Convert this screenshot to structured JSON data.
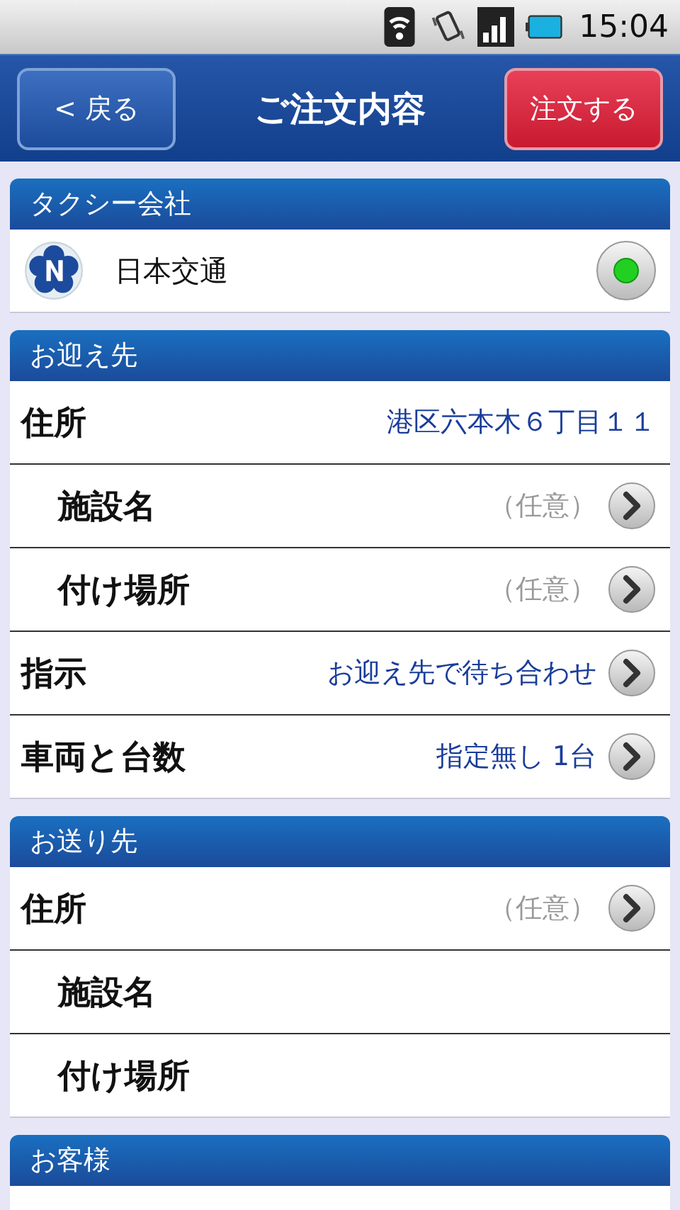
{
  "status_bar": {
    "time": "15:04"
  },
  "header": {
    "back": "< 戻る",
    "title": "ご注文内容",
    "order": "注文する"
  },
  "sections": [
    {
      "title": "タクシー会社",
      "kind": "company",
      "company": {
        "name": "日本交通",
        "selected": true
      }
    },
    {
      "title": "お迎え先",
      "kind": "rows",
      "rows": [
        {
          "label": "住所",
          "indent": false,
          "value": "港区六本木６丁目１１",
          "muted": false,
          "chevron": false
        },
        {
          "label": "施設名",
          "indent": true,
          "value": "（任意）",
          "muted": true,
          "chevron": true
        },
        {
          "label": "付け場所",
          "indent": true,
          "value": "（任意）",
          "muted": true,
          "chevron": true
        },
        {
          "label": "指示",
          "indent": false,
          "value": "お迎え先で待ち合わせ",
          "muted": false,
          "chevron": true
        },
        {
          "label": "車両と台数",
          "indent": false,
          "value": "指定無し 1台",
          "muted": false,
          "chevron": true
        }
      ]
    },
    {
      "title": "お送り先",
      "kind": "rows",
      "rows": [
        {
          "label": "住所",
          "indent": false,
          "value": "（任意）",
          "muted": true,
          "chevron": true
        },
        {
          "label": "施設名",
          "indent": true,
          "chevron": false
        },
        {
          "label": "付け場所",
          "indent": true,
          "chevron": false
        }
      ]
    },
    {
      "title": "お客様",
      "kind": "rows"
    }
  ]
}
